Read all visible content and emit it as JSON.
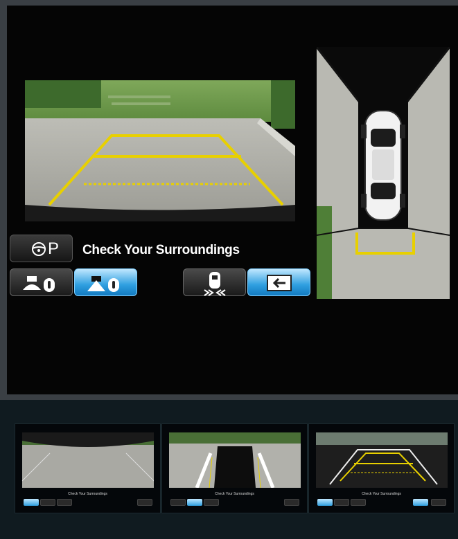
{
  "main": {
    "status_text": "Check Your Surroundings",
    "park_label": "P",
    "park_icon": "steering-wheel-icon",
    "buttons": [
      {
        "icon": "front-camera-icon",
        "state": "inactive"
      },
      {
        "icon": "rear-camera-icon",
        "state": "active"
      },
      {
        "icon": "car-side-view-icon",
        "state": "inactive"
      },
      {
        "icon": "exit-icon",
        "state": "active"
      }
    ]
  },
  "thumbnails": [
    {
      "view": "front-wide",
      "caption": "Check Your Surroundings"
    },
    {
      "view": "top-down-rear",
      "caption": "Check Your Surroundings"
    },
    {
      "view": "rear-guidelines",
      "caption": "Check Your Surroundings"
    }
  ],
  "colors": {
    "guideline": "#e8d000",
    "button_active": "#2f9fe0",
    "screen_bg": "#050505"
  }
}
